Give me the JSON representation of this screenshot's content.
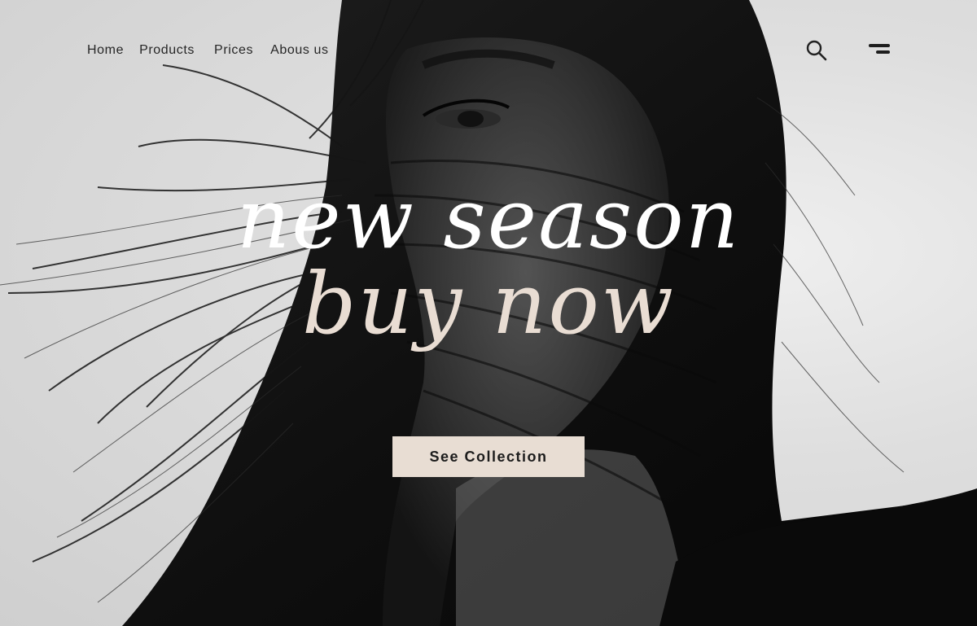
{
  "nav": {
    "items": [
      {
        "label": "Home"
      },
      {
        "label": "Products"
      },
      {
        "label": "Prices"
      },
      {
        "label": "Abous us"
      }
    ]
  },
  "header": {
    "search_icon": "search-icon",
    "menu_icon": "menu-icon"
  },
  "hero": {
    "headline_line1": "new season",
    "headline_line2": "buy now",
    "cta_label": "See Collection",
    "colors": {
      "headline_line1": "#ffffff",
      "headline_line2": "#e9ddd3",
      "cta_background": "#e8ddd3",
      "text_dark": "#1c1c1c"
    }
  }
}
